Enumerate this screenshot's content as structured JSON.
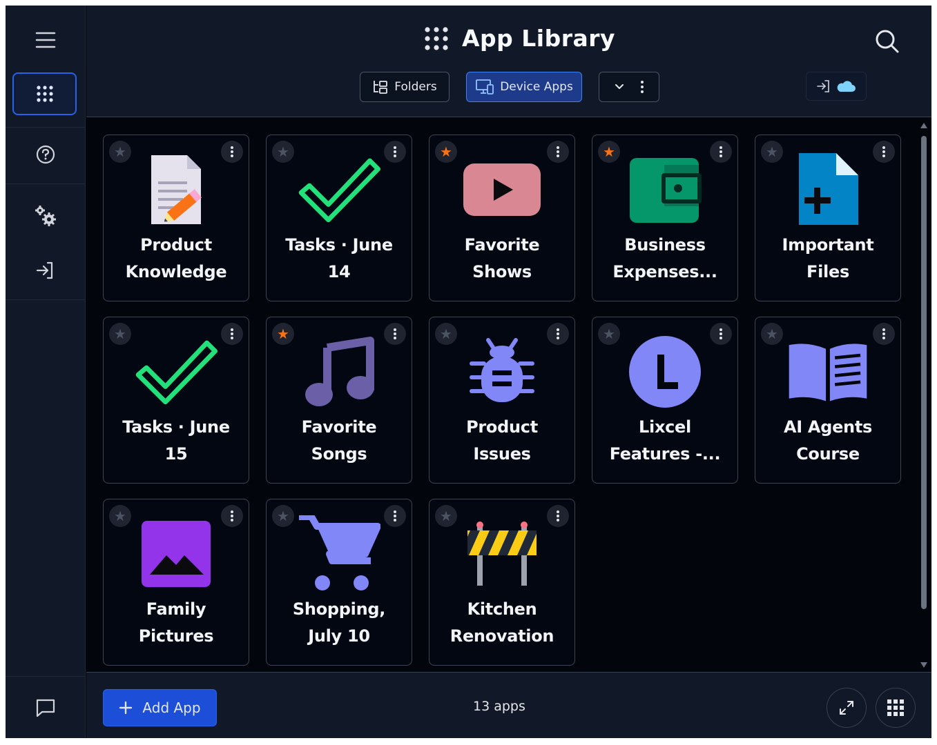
{
  "header": {
    "title": "App Library",
    "tabs": [
      {
        "label": "Folders",
        "icon": "folder-tree-icon"
      },
      {
        "label": "Device Apps",
        "icon": "device-icon"
      }
    ]
  },
  "sidebar": {
    "items": [
      {
        "name": "menu",
        "icon": "hamburger-icon"
      },
      {
        "name": "apps",
        "icon": "grid-icon"
      },
      {
        "name": "help",
        "icon": "help-icon"
      },
      {
        "name": "settings",
        "icon": "gears-icon"
      },
      {
        "name": "sign-in",
        "icon": "sign-in-icon"
      },
      {
        "name": "chat",
        "icon": "chat-icon"
      }
    ]
  },
  "apps": [
    {
      "name": "Product Knowledge",
      "line1": "Product",
      "line2": "Knowledge",
      "favorite": false,
      "icon": "document-pencil-icon"
    },
    {
      "name": "Tasks · June 14",
      "line1": "Tasks · June",
      "line2": "14",
      "favorite": false,
      "icon": "checkmark-icon"
    },
    {
      "name": "Favorite Shows",
      "line1": "Favorite",
      "line2": "Shows",
      "favorite": true,
      "icon": "video-play-icon"
    },
    {
      "name": "Business Expenses...",
      "line1": "Business",
      "line2": "Expenses...",
      "favorite": true,
      "icon": "wallet-icon"
    },
    {
      "name": "Important Files",
      "line1": "Important",
      "line2": "Files",
      "favorite": false,
      "icon": "file-plus-icon"
    },
    {
      "name": "Tasks · June 15",
      "line1": "Tasks · June",
      "line2": "15",
      "favorite": false,
      "icon": "checkmark-icon"
    },
    {
      "name": "Favorite Songs",
      "line1": "Favorite",
      "line2": "Songs",
      "favorite": true,
      "icon": "music-note-icon"
    },
    {
      "name": "Product Issues",
      "line1": "Product",
      "line2": "Issues",
      "favorite": false,
      "icon": "bug-icon"
    },
    {
      "name": "Lixcel Features -...",
      "line1": "Lixcel",
      "line2": "Features -...",
      "favorite": false,
      "icon": "letter-l-icon"
    },
    {
      "name": "AI Agents Course",
      "line1": "AI Agents",
      "line2": "Course",
      "favorite": false,
      "icon": "open-book-icon"
    },
    {
      "name": "Family Pictures",
      "line1": "Family",
      "line2": "Pictures",
      "favorite": false,
      "icon": "image-icon"
    },
    {
      "name": "Shopping, July 10",
      "line1": "Shopping,",
      "line2": "July 10",
      "favorite": false,
      "icon": "shopping-cart-icon"
    },
    {
      "name": "Kitchen Renovation",
      "line1": "Kitchen",
      "line2": "Renovation",
      "favorite": false,
      "icon": "construction-barrier-icon"
    }
  ],
  "footer": {
    "add_label": "Add App",
    "count_label": "13 apps"
  },
  "colors": {
    "accent": "#2563eb",
    "favorite": "#f97316",
    "check": "#22e07a",
    "periwinkle": "#8187f7"
  }
}
